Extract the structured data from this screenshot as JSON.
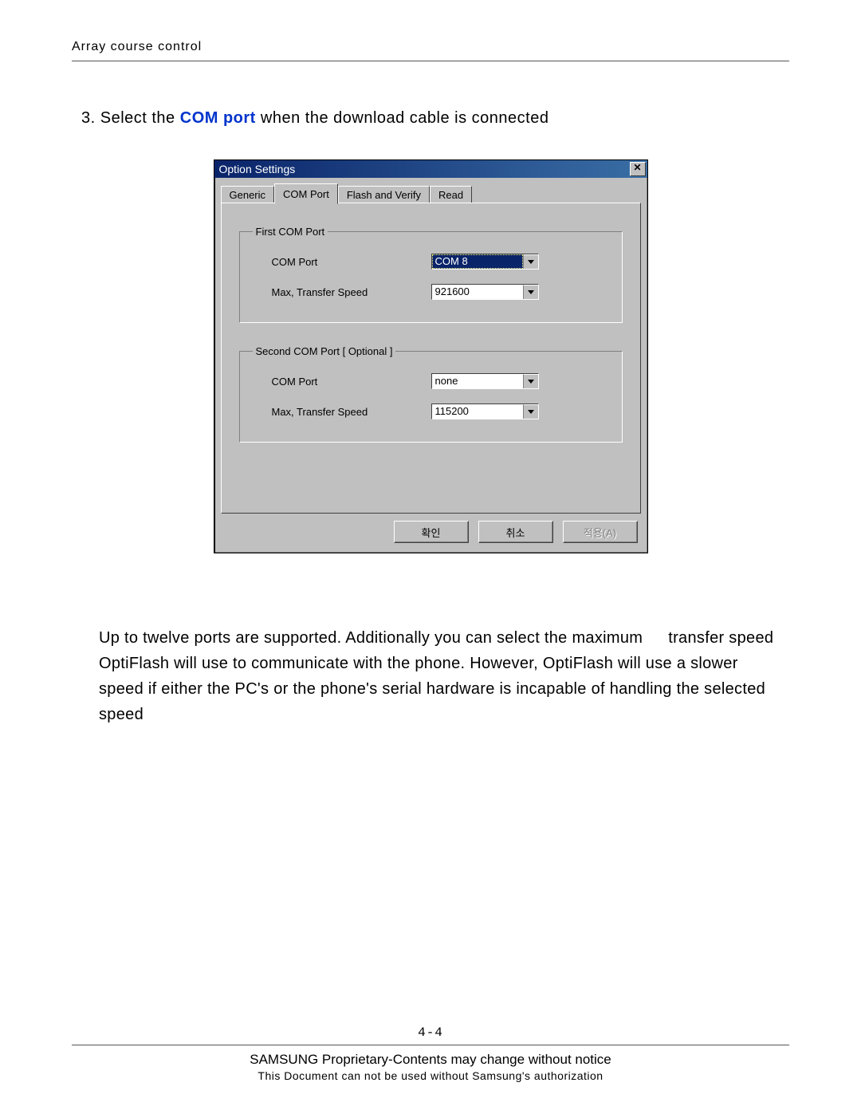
{
  "header": "Array course control",
  "instruction": {
    "prefix": "3. Select the ",
    "emph": "COM port",
    "suffix": " when the download cable is connected"
  },
  "dialog": {
    "title": "Option Settings",
    "close_glyph": "✕",
    "tabs": [
      "Generic",
      "COM Port",
      "Flash and Verify",
      "Read"
    ],
    "active_tab_index": 1,
    "group1": {
      "legend": "First COM Port",
      "com_label": "COM Port",
      "com_value": "COM 8",
      "speed_label": "Max, Transfer Speed",
      "speed_value": "921600"
    },
    "group2": {
      "legend": "Second COM Port [ Optional ]",
      "com_label": "COM Port",
      "com_value": "none",
      "speed_label": "Max, Transfer Speed",
      "speed_value": "115200"
    },
    "buttons": {
      "ok": "확인",
      "cancel": "취소",
      "apply": "적용(A)"
    }
  },
  "paragraph": "Up to twelve ports are supported. Additionally you can select the maximum   transfer speed OptiFlash will use to communicate with the phone. However, OptiFlash will use a slower speed if either the PC's or the phone's serial hardware is incapable of handling the selected speed",
  "footer": {
    "pagenum": "4-4",
    "line1": "SAMSUNG Proprietary-Contents may change without notice",
    "line2": "This Document can not be used without Samsung's authorization"
  }
}
